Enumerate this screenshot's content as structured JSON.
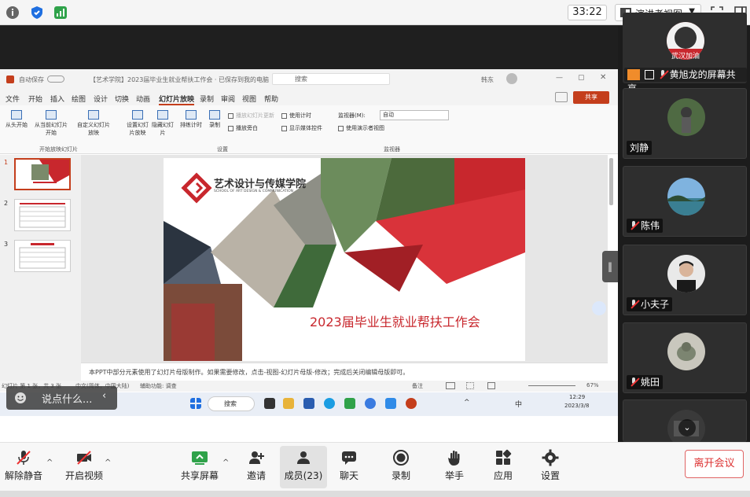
{
  "topbar": {
    "timer": "33:22",
    "view_button": "演讲者视图",
    "view_arrow": "▼"
  },
  "ppt": {
    "autosave": "自动保存",
    "doc_title": "【艺术学院】2023届毕业生就业帮扶工作会 · 已保存到我的电脑 ⌄",
    "search": "搜索",
    "user": "韩东",
    "menu": [
      "文件",
      "开始",
      "插入",
      "绘图",
      "设计",
      "切换",
      "动画",
      "幻灯片放映",
      "录制",
      "审阅",
      "视图",
      "帮助"
    ],
    "share": "共享",
    "ribbon": {
      "btn1": "从头开始",
      "btn2": "从当前幻灯片开始",
      "btn3": "自定义幻灯片放映",
      "btn4": "设置幻灯片放映",
      "btn5": "隐藏幻灯片",
      "btn6": "排练计时",
      "btn7": "录制",
      "chk1": "播放幻灯片更新",
      "chk2": "播放旁白",
      "chk3": "使用计时",
      "chk4": "显示媒体控件",
      "monitor": "监视器(M):",
      "monitor_value": "自动",
      "presenter": "使用演示者视图",
      "grp1": "开始放映幻灯片",
      "grp2": "设置",
      "grp3": "监视器"
    },
    "thumbs": [
      "1",
      "2",
      "3"
    ],
    "slide": {
      "school_cn": "艺术设计与传媒学院",
      "school_en": "SCHOOL OF ART DESIGN & COMMUNICATION",
      "title": "2023届毕业生就业帮扶工作会"
    },
    "notes": "本PPT中部分元素使用了幻灯片母版制作。如果需要修改，点击-视图-幻灯片母版-修改；完成后关闭编辑母版即可。",
    "status": {
      "slide_count": "幻灯片 第 1 张，共 3 张",
      "lang": "中文(简体，中国大陆)",
      "access": "辅助功能: 调查",
      "notes_btn": "备注",
      "zoom": "67%"
    },
    "taskbar": {
      "search": "搜索",
      "time": "12:29",
      "date": "2023/3/8",
      "ime": "中"
    }
  },
  "comment_placeholder": "说点什么...",
  "participants": [
    {
      "name": "黄旭龙的屏幕共享",
      "avatar_text": "武汉加油"
    },
    {
      "name": "刘静"
    },
    {
      "name": "陈伟"
    },
    {
      "name": "小夫子"
    },
    {
      "name": "姚田"
    }
  ],
  "toolbar": {
    "mute": "解除静音",
    "video": "开启视频",
    "share": "共享屏幕",
    "invite": "邀请",
    "members": "成员(23)",
    "chat": "聊天",
    "record": "录制",
    "hand": "举手",
    "apps": "应用",
    "settings": "设置",
    "leave": "离开会议"
  },
  "colors": {
    "accent_red": "#c8272d",
    "ppt_orange": "#c43e1c",
    "green_signal": "#2fa24a",
    "shield_blue": "#1f6fe0"
  }
}
